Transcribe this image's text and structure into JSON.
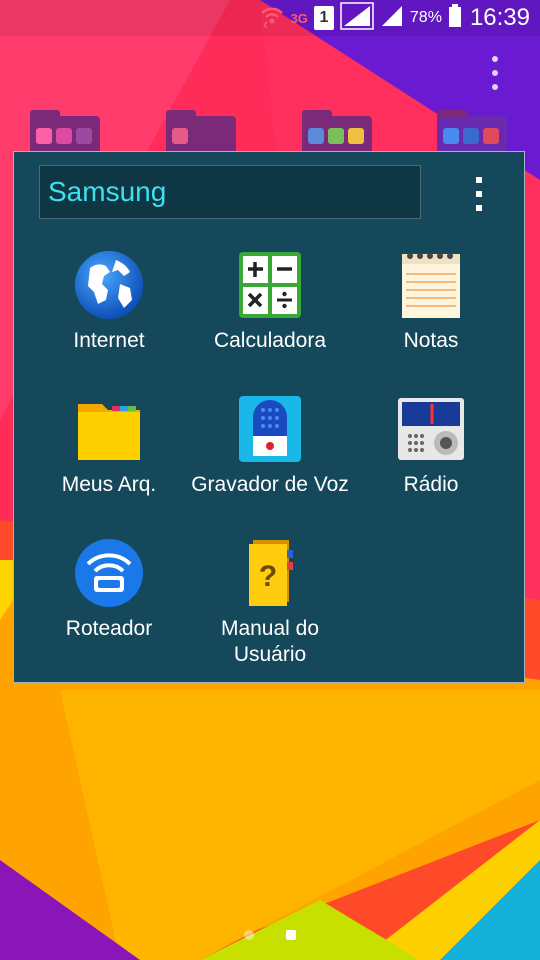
{
  "status_bar": {
    "network_label": "3G",
    "sim_label": "1",
    "battery_percent": "78%",
    "time": "16:39"
  },
  "folder": {
    "title": "Samsung",
    "apps": [
      {
        "label": "Internet",
        "icon": "globe-icon"
      },
      {
        "label": "Calculadora",
        "icon": "calculator-icon"
      },
      {
        "label": "Notas",
        "icon": "notes-icon"
      },
      {
        "label": "Meus Arq.",
        "icon": "folder-icon"
      },
      {
        "label": "Gravador de Voz",
        "icon": "microphone-icon"
      },
      {
        "label": "Rádio",
        "icon": "radio-icon"
      },
      {
        "label": "Roteador",
        "icon": "router-icon"
      },
      {
        "label": "Manual do Usuário",
        "icon": "manual-book-icon"
      }
    ]
  },
  "home_pages": {
    "count": 2,
    "current": 2
  },
  "colors": {
    "panel": "#15485a",
    "title_text": "#3ce0ee"
  }
}
